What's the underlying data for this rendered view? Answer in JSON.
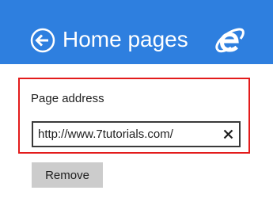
{
  "header": {
    "title": "Home pages",
    "background_color": "#2e7fdf",
    "back_icon": "back-arrow-circle-icon",
    "logo_icon": "internet-explorer-logo-icon"
  },
  "form": {
    "label": "Page address",
    "address_value": "http://www.7tutorials.com/",
    "clear_icon": "close-icon",
    "highlight_color": "#e31b1b"
  },
  "actions": {
    "remove_label": "Remove"
  }
}
